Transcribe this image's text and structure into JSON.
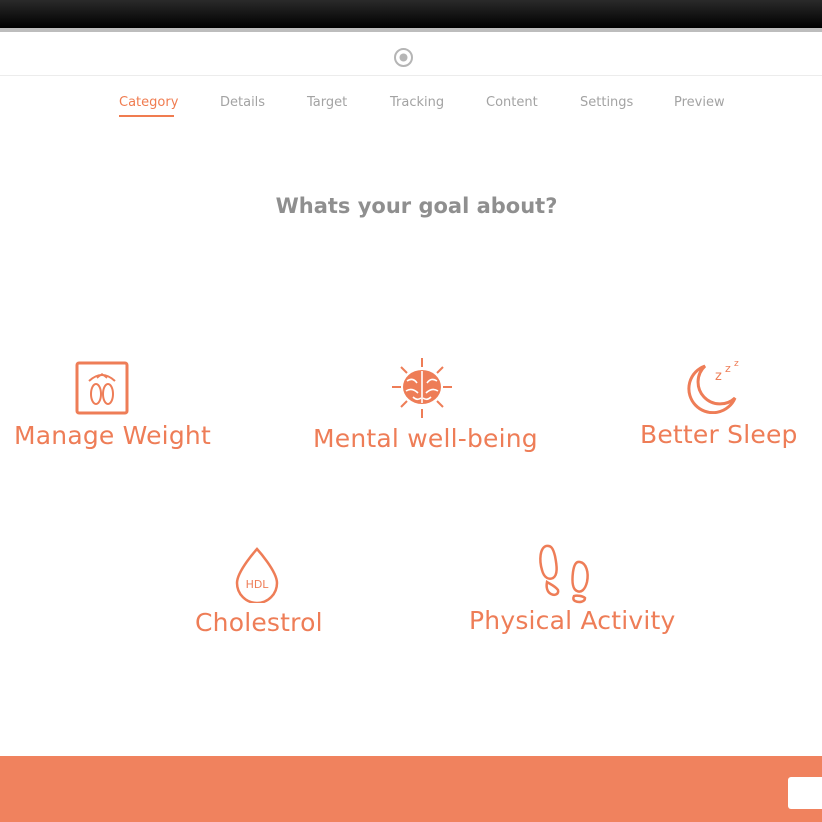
{
  "tabs": [
    "Category",
    "Details",
    "Target",
    "Tracking",
    "Content",
    "Settings",
    "Preview"
  ],
  "active_tab": "Category",
  "question": "Whats your goal about?",
  "goals": {
    "manage_weight": "Manage Weight",
    "mental_wellbeing": "Mental well-being",
    "better_sleep": "Better Sleep",
    "cholestrol": "Cholestrol",
    "physical_activity": "Physical Activity"
  },
  "icon_text": {
    "hdl": "HDL",
    "sleep_z": "z"
  },
  "colors": {
    "accent": "#f07c50",
    "goal_text": "#ee7d57",
    "footer": "#f0825e",
    "tab_inactive": "#a3a3a3",
    "question": "#8f8f8f"
  },
  "icons": [
    "record-icon",
    "scale-icon",
    "brain-icon",
    "moon-sleep-icon",
    "hdl-drop-icon",
    "footprints-icon"
  ]
}
